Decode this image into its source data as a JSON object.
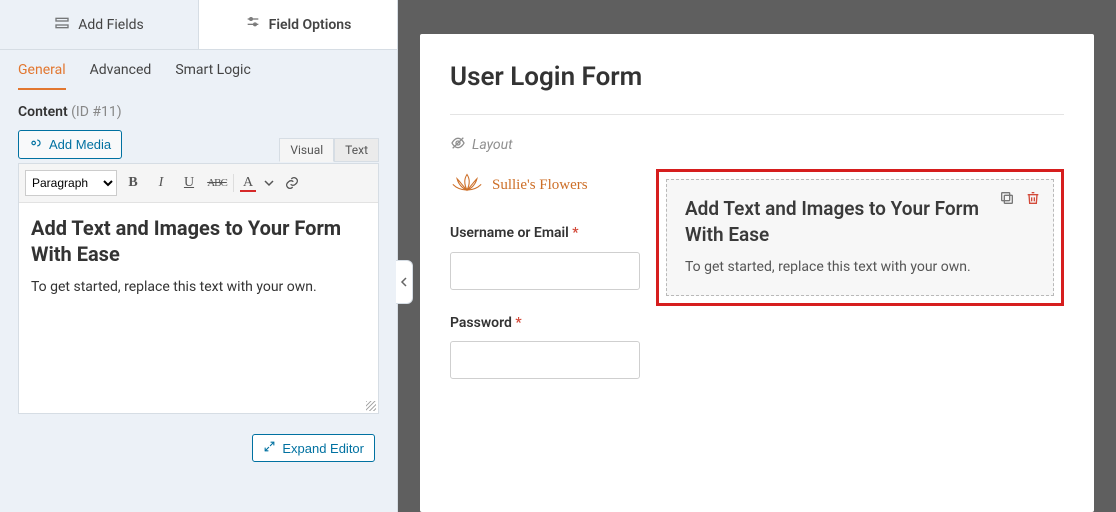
{
  "topTabs": {
    "addFields": "Add Fields",
    "fieldOptions": "Field Options"
  },
  "subTabs": {
    "general": "General",
    "advanced": "Advanced",
    "smartLogic": "Smart Logic"
  },
  "contentHeader": {
    "label": "Content",
    "id": "(ID #11)"
  },
  "buttons": {
    "addMedia": "Add Media",
    "expandEditor": "Expand Editor"
  },
  "editor": {
    "paragraphOption": "Paragraph",
    "modeVisual": "Visual",
    "modeText": "Text",
    "heading": "Add Text and Images to Your Form With Ease",
    "body": "To get started, replace this text with your own."
  },
  "preview": {
    "formTitle": "User Login Form",
    "layoutLabel": "Layout",
    "logoText": "Sullie's Flowers",
    "block": {
      "heading": "Add Text and Images to Your Form With Ease",
      "body": "To get started, replace this text with your own."
    },
    "fields": {
      "usernameLabel": "Username or Email",
      "passwordLabel": "Password"
    }
  }
}
